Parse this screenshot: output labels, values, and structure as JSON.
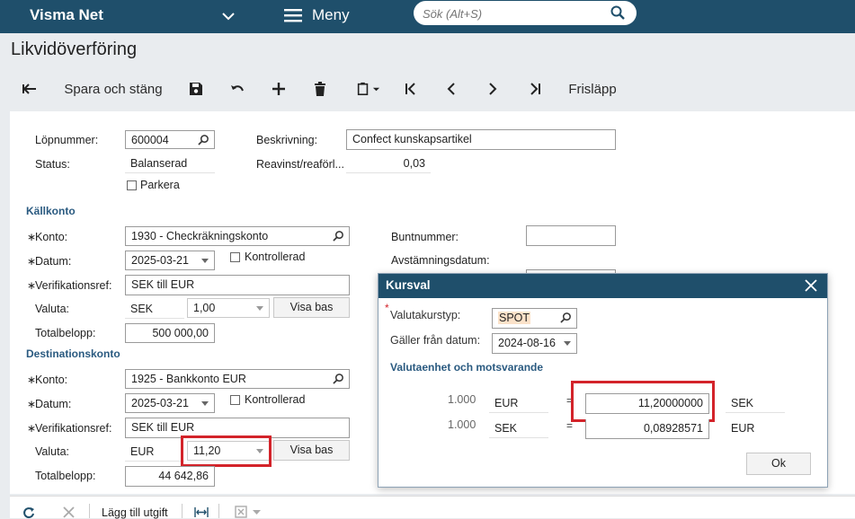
{
  "topbar": {
    "brand": "Visma Net",
    "menu_label": "Meny",
    "search_placeholder": "Sök (Alt+S)"
  },
  "page": {
    "title": "Likvidöverföring"
  },
  "toolbar": {
    "save_close_label": "Spara och stäng",
    "release_label": "Frisläpp"
  },
  "form": {
    "lopnummer_label": "Löpnummer:",
    "lopnummer_value": "600004",
    "status_label": "Status:",
    "status_value": "Balanserad",
    "parkera_label": "Parkera",
    "beskrivning_label": "Beskrivning:",
    "beskrivning_value": "Confect kunskapsartikel",
    "reavinst_label": "Reavinst/reaförl...",
    "reavinst_value": "0,03",
    "source_section": "Källkonto",
    "source": {
      "konto_label": "Konto:",
      "konto_value": "1930 - Checkräkningskonto",
      "datum_label": "Datum:",
      "datum_value": "2025-03-21",
      "kontrollerad_label": "Kontrollerad",
      "verref_label": "Verifikationsref:",
      "verref_value": "SEK till EUR",
      "valuta_label": "Valuta:",
      "valuta_code": "SEK",
      "valuta_rate": "1,00",
      "visa_bas": "Visa bas",
      "total_label": "Totalbelopp:",
      "total_value": "500 000,00"
    },
    "buntnummer_label": "Buntnummer:",
    "avstamning_label": "Avstämningsdatum:",
    "dest_section": "Destinationskonto",
    "dest": {
      "konto_label": "Konto:",
      "konto_value": "1925 - Bankkonto EUR",
      "datum_label": "Datum:",
      "datum_value": "2025-03-21",
      "kontrollerad_label": "Kontrollerad",
      "verref_label": "Verifikationsref:",
      "verref_value": "SEK till EUR",
      "valuta_label": "Valuta:",
      "valuta_code": "EUR",
      "valuta_rate": "11,20",
      "visa_bas": "Visa bas",
      "total_label": "Totalbelopp:",
      "total_value": "44 642,86"
    },
    "required_mark": "∗"
  },
  "bottombar": {
    "add_row_label": "Lägg till utgift"
  },
  "dialog": {
    "title": "Kursval",
    "required_mark": "*",
    "kurstyp_label": "Valutakurstyp:",
    "kurstyp_value": "SPOT",
    "galler_label": "Gäller från datum:",
    "galler_value": "2024-08-16",
    "section": "Valutaenhet och motsvarande",
    "row1": {
      "amount": "1.000",
      "from": "EUR",
      "eq": "=",
      "rate": "11,20000000",
      "to": "SEK"
    },
    "row2": {
      "amount": "1.000",
      "from": "SEK",
      "eq": "=",
      "rate": "0,08928571",
      "to": "EUR"
    },
    "ok_label": "Ok"
  },
  "colors": {
    "header": "#1f4f6b",
    "highlight": "#d3232a",
    "section": "#2a5a80"
  }
}
